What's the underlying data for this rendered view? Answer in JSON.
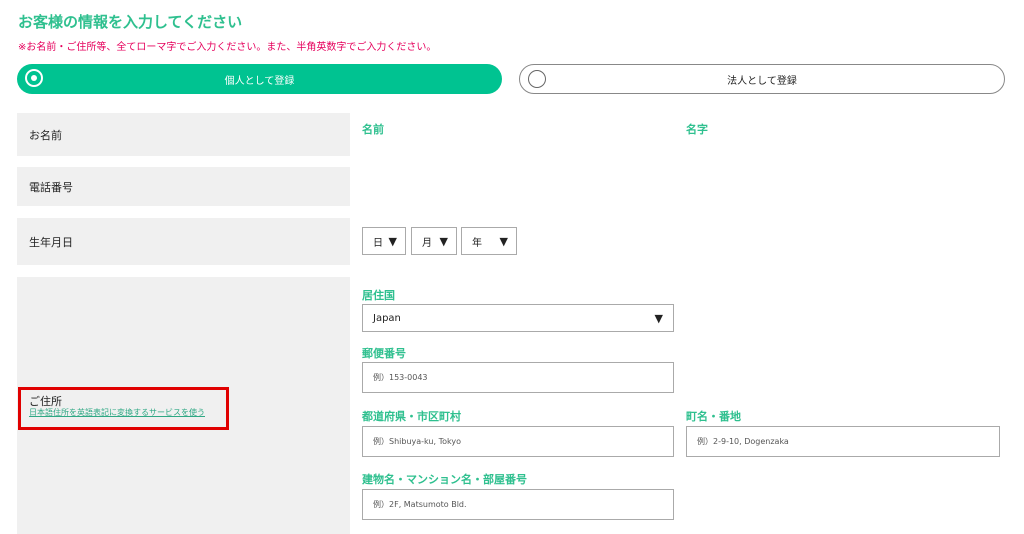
{
  "header": {
    "title": "お客様の情報を入力してください",
    "notice": "※お名前・ご住所等、全てローマ字でご入力ください。また、半角英数字でご入力ください。"
  },
  "account_type": {
    "individual_label": "個人として登録",
    "corporate_label": "法人として登録",
    "selected": "individual"
  },
  "rows": {
    "name_label": "お名前",
    "phone_label": "電話番号",
    "birthdate_label": "生年月日",
    "address_label": "ご住所",
    "address_link": "日本語住所を英語表記に変換するサービスを使う"
  },
  "name": {
    "first_label": "名前",
    "last_label": "名字"
  },
  "birthdate": {
    "day": "日",
    "month": "月",
    "year": "年"
  },
  "address": {
    "country_label": "居住国",
    "country_value": "Japan",
    "postal_label": "郵便番号",
    "postal_placeholder": "例）153-0043",
    "city_label": "都道府県・市区町村",
    "city_placeholder": "例）Shibuya-ku, Tokyo",
    "street_label": "町名・番地",
    "street_placeholder": "例）2-9-10, Dogenzaka",
    "building_label": "建物名・マンション名・部屋番号",
    "building_placeholder": "例）2F, Matsumoto Bld."
  },
  "colors": {
    "accent": "#00c391",
    "label_green": "#2fc08f",
    "notice_red": "#e6005c",
    "highlight_red": "#e00000",
    "cell_gray": "#f0f0f0"
  },
  "icons": {
    "dropdown": "down-triangle-icon",
    "radio": "radio-icon"
  }
}
